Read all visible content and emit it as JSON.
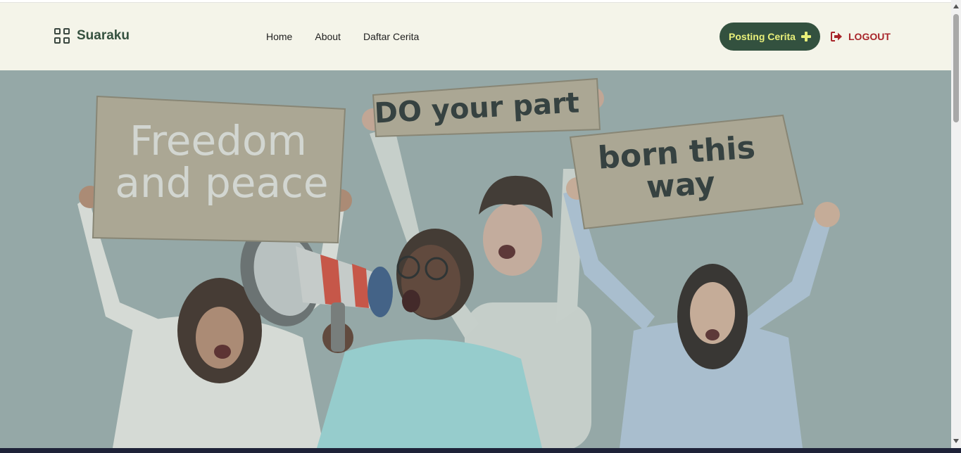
{
  "navbar": {
    "brand": "Suaraku",
    "links": [
      "Home",
      "About",
      "Daftar Cerita"
    ],
    "post_button": "Posting Cerita",
    "logout": "LOGOUT"
  },
  "hero": {
    "signs": {
      "left": [
        "Freedom",
        "and peace"
      ],
      "middle": "DO your part",
      "right": [
        "born this",
        "way"
      ]
    }
  },
  "colors": {
    "navbar_bg": "#f4f4e9",
    "brand": "#35513f",
    "button_bg": "#33513f",
    "button_text": "#e8ef7a",
    "logout": "#a8252a"
  }
}
